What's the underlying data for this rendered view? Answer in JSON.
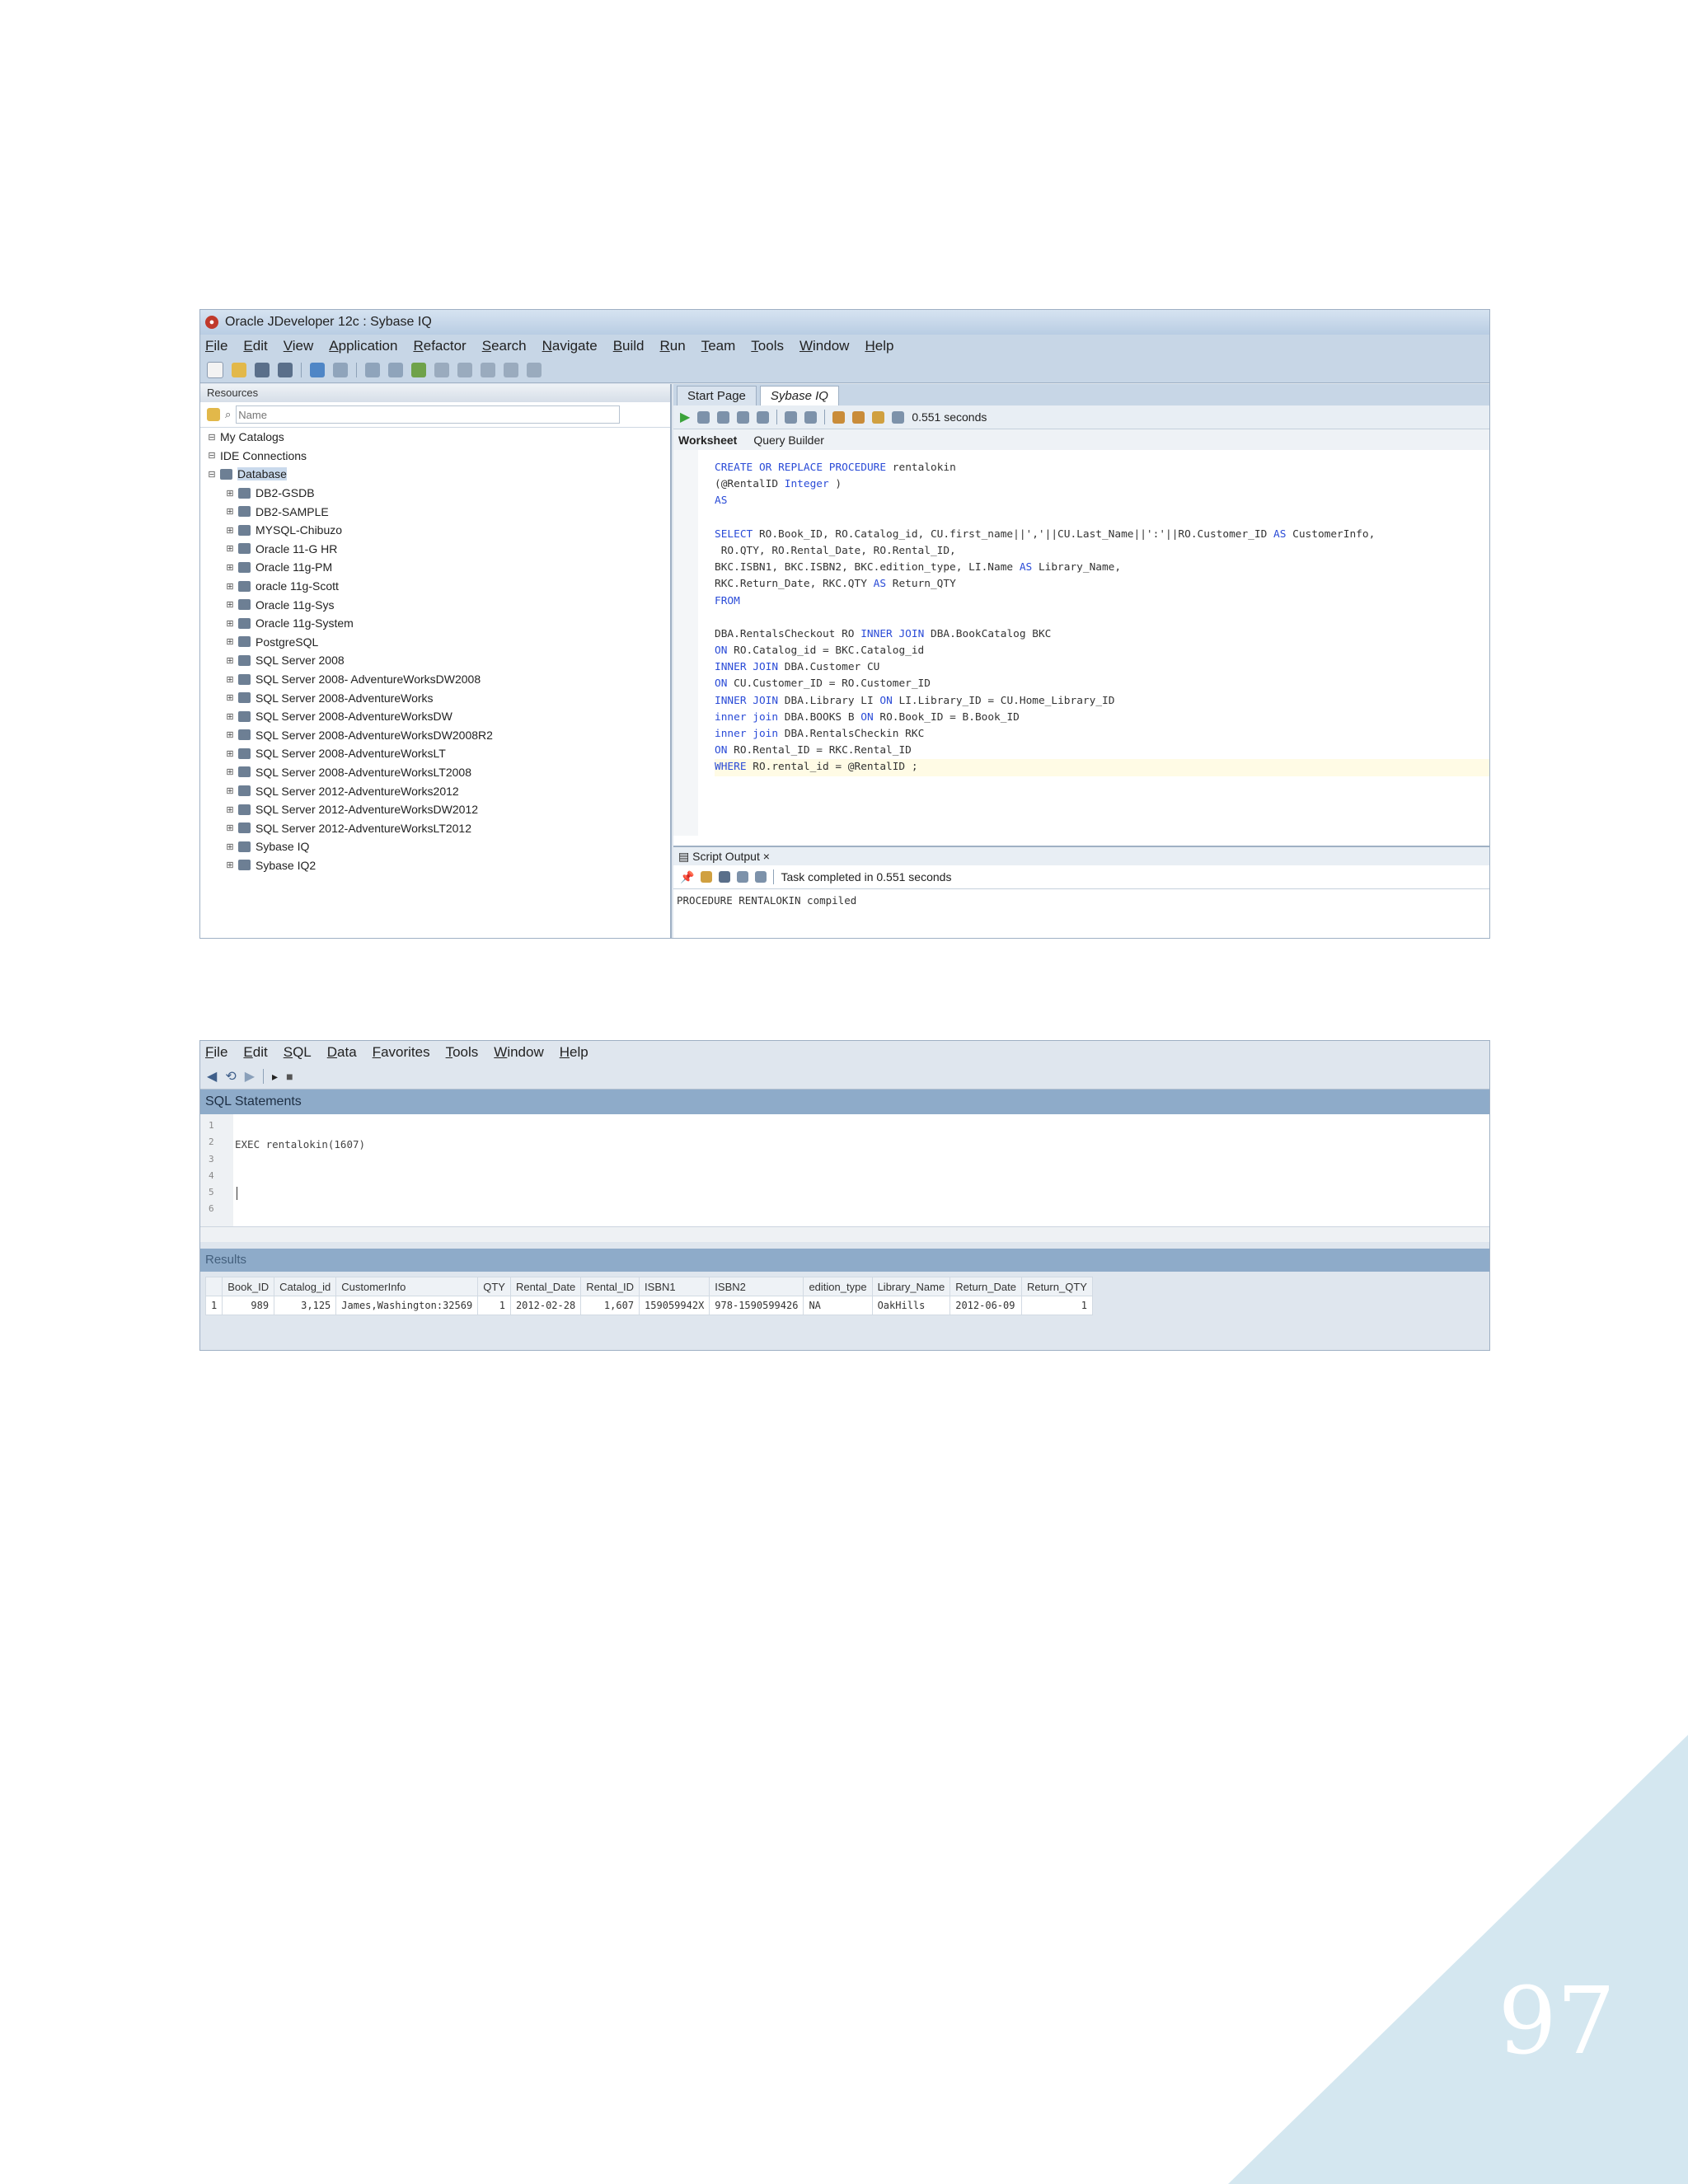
{
  "jdev": {
    "window_title": "Oracle JDeveloper 12c : Sybase IQ",
    "menu": [
      "File",
      "Edit",
      "View",
      "Application",
      "Refactor",
      "Search",
      "Navigate",
      "Build",
      "Run",
      "Team",
      "Tools",
      "Window",
      "Help"
    ],
    "resources": {
      "pane_title": "Resources",
      "search_placeholder": "Name",
      "catalogs_label": "My Catalogs",
      "ide_connections_label": "IDE Connections",
      "database_label": "Database",
      "connections": [
        "DB2-GSDB",
        "DB2-SAMPLE",
        "MYSQL-Chibuzo",
        "Oracle 11-G HR",
        "Oracle 11g-PM",
        "oracle 11g-Scott",
        "Oracle 11g-Sys",
        "Oracle 11g-System",
        "PostgreSQL",
        "SQL Server 2008",
        "SQL Server 2008- AdventureWorksDW2008",
        "SQL Server 2008-AdventureWorks",
        "SQL Server 2008-AdventureWorksDW",
        "SQL Server 2008-AdventureWorksDW2008R2",
        "SQL Server 2008-AdventureWorksLT",
        "SQL Server 2008-AdventureWorksLT2008",
        "SQL Server 2012-AdventureWorks2012",
        "SQL Server 2012-AdventureWorksDW2012",
        "SQL Server 2012-AdventureWorksLT2012",
        "Sybase IQ",
        "Sybase IQ2"
      ]
    },
    "editor": {
      "tabs": [
        "Start Page",
        "Sybase IQ"
      ],
      "timing": "0.551 seconds",
      "subtabs": [
        "Worksheet",
        "Query Builder"
      ],
      "code_lines": [
        "CREATE OR REPLACE PROCEDURE rentalokin",
        "(@RentalID Integer )",
        "AS",
        "",
        "SELECT RO.Book_ID, RO.Catalog_id, CU.first_name||','||CU.Last_Name||':'||RO.Customer_ID AS CustomerInfo,",
        " RO.QTY, RO.Rental_Date, RO.Rental_ID,",
        "BKC.ISBN1, BKC.ISBN2, BKC.edition_type, LI.Name AS Library_Name,",
        "RKC.Return_Date, RKC.QTY AS Return_QTY",
        "FROM",
        "",
        "DBA.RentalsCheckout RO INNER JOIN DBA.BookCatalog BKC",
        "ON RO.Catalog_id = BKC.Catalog_id",
        "INNER JOIN DBA.Customer CU",
        "ON CU.Customer_ID = RO.Customer_ID",
        "INNER JOIN DBA.Library LI ON LI.Library_ID = CU.Home_Library_ID",
        "inner join DBA.BOOKS B ON RO.Book_ID = B.Book_ID",
        "inner join DBA.RentalsCheckin RKC",
        "ON RO.Rental_ID = RKC.Rental_ID",
        "WHERE RO.rental_id = @RentalID ;"
      ]
    },
    "script_output": {
      "tab_label": "Script Output",
      "status": "Task completed in 0.551 seconds",
      "message": "PROCEDURE RENTALOKIN compiled"
    }
  },
  "sqltool": {
    "menu": [
      "File",
      "Edit",
      "SQL",
      "Data",
      "Favorites",
      "Tools",
      "Window",
      "Help"
    ],
    "statements_title": "SQL Statements",
    "line_numbers": [
      "1",
      "2",
      "3",
      "4",
      "5",
      "6"
    ],
    "statement": "EXEC rentalokin(1607)",
    "results_title": "Results",
    "columns": [
      "Book_ID",
      "Catalog_id",
      "CustomerInfo",
      "QTY",
      "Rental_Date",
      "Rental_ID",
      "ISBN1",
      "ISBN2",
      "edition_type",
      "Library_Name",
      "Return_Date",
      "Return_QTY"
    ],
    "rows": [
      [
        "1",
        "989",
        "3,125",
        "James,Washington:32569",
        "1",
        "2012-02-28",
        "1,607",
        "159059942X",
        "978-1590599426",
        "NA",
        "OakHills",
        "2012-06-09",
        "1"
      ]
    ]
  },
  "page_number": "97",
  "colors": {
    "corner": "#d4e7f0",
    "accent": "#8eabc9"
  }
}
